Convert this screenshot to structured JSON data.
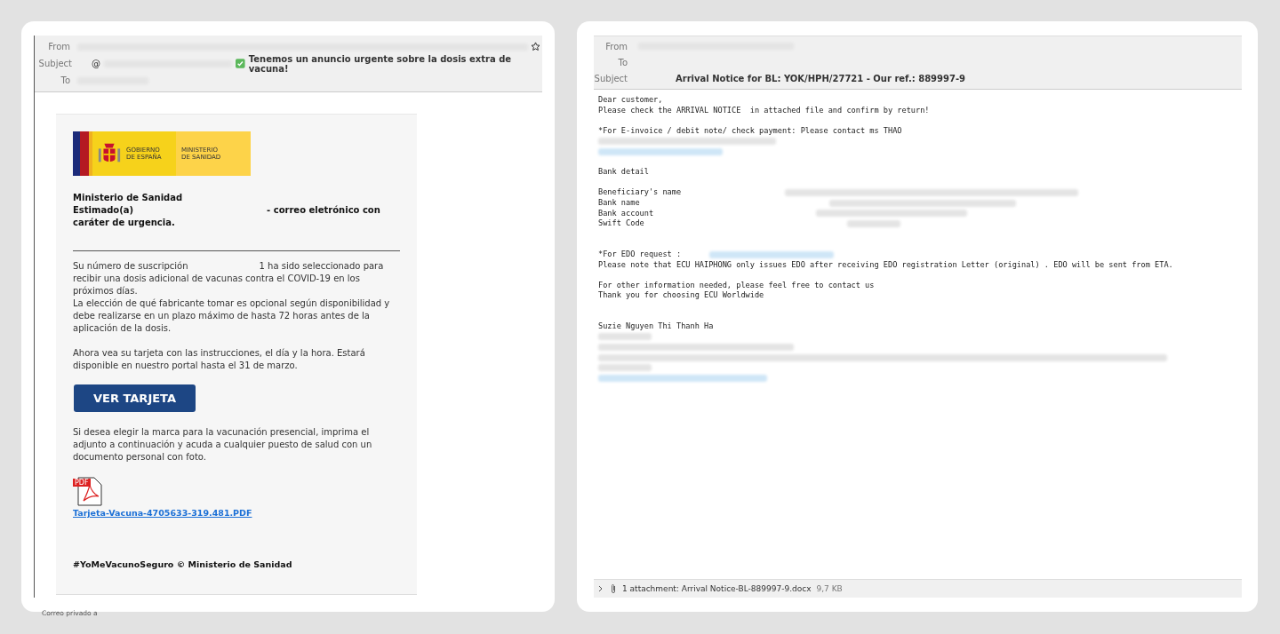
{
  "left_email": {
    "header": [
      {
        "kind": "from",
        "label": "From"
      },
      {
        "kind": "subject",
        "label": "Subject",
        "prefix": "@",
        "value": "Tenemos un anuncio urgente sobre la dosis extra de vacuna!"
      },
      {
        "kind": "to",
        "label": "To"
      }
    ],
    "logo": {
      "left_lines": [
        "GOBIERNO",
        "DE ESPAÑA"
      ],
      "right_lines": [
        "MINISTERIO",
        "DE SANIDAD"
      ]
    },
    "heading": {
      "line1": "Ministerio de Sanidad",
      "greeting": "Estimado(a)",
      "rest": "- correo eletrónico con caráter de urgencia."
    },
    "intro": {
      "before": "Su número de suscripción",
      "after": "1 ha sido seleccionado para recibir una dosis adicional de vacunas contra el COVID-19 en los próximos días.",
      "second": "La elección de qué fabricante tomar es opcional según disponibilidad y debe realizarse en un plazo máximo de hasta 72 horas antes de la aplicación de la dosis."
    },
    "paragraph2": "Ahora vea su tarjeta con las instrucciones, el día y la hora. Estará disponible en nuestro portal hasta el 31 de marzo.",
    "button": "VER TARJETA",
    "paragraph3": "Si desea elegir la marca para la vacunación presencial, imprima el adjunto a continuación y acuda a cualquier puesto de salud con un documento personal con foto.",
    "attachment": {
      "icon_label": "PDF",
      "link": "Tarjeta-Vacuna-4705633-319.481.PDF"
    },
    "footer": "#YoMeVacunoSeguro © Ministerio de Sanidad",
    "private_note": "Correo privado a"
  },
  "right_email": {
    "header": [
      {
        "kind": "from",
        "label": "From"
      },
      {
        "kind": "to",
        "label": "To"
      },
      {
        "kind": "subject",
        "label": "Subject",
        "value": "Arrival Notice for BL: YOK/HPH/27721 - Our ref.: 889997-9"
      }
    ],
    "lines": [
      {
        "kind": "text",
        "text": "Dear customer,"
      },
      {
        "kind": "text",
        "text": "Please check the ARRIVAL NOTICE  in attached file and confirm by return!"
      },
      {
        "kind": "gap"
      },
      {
        "kind": "text",
        "text": "*For E-invoice / debit note/ check payment: Please contact ms THAO"
      },
      {
        "kind": "redacted"
      },
      {
        "kind": "redacted_link"
      },
      {
        "kind": "gap"
      },
      {
        "kind": "text",
        "text": "Bank detail"
      },
      {
        "kind": "gap"
      },
      {
        "kind": "field",
        "text": "Beneficiary's name"
      },
      {
        "kind": "field",
        "text": "Bank name"
      },
      {
        "kind": "field",
        "text": "Bank account"
      },
      {
        "kind": "field",
        "text": "Swift Code"
      },
      {
        "kind": "gap"
      },
      {
        "kind": "gap"
      },
      {
        "kind": "field_link",
        "text": "*For EDO request :"
      },
      {
        "kind": "text",
        "text": "Please note that ECU HAIPHONG only issues EDO after receiving EDO registration Letter (original) . EDO will be sent from ETA."
      },
      {
        "kind": "gap"
      },
      {
        "kind": "text",
        "text": "For other information needed, please feel free to contact us"
      },
      {
        "kind": "text",
        "text": "Thank you for choosing ECU Worldwide"
      },
      {
        "kind": "gap"
      },
      {
        "kind": "gap"
      },
      {
        "kind": "text",
        "text": "Suzie Nguyen Thi Thanh Ha"
      },
      {
        "kind": "redacted"
      },
      {
        "kind": "redacted"
      },
      {
        "kind": "redacted"
      },
      {
        "kind": "redacted"
      },
      {
        "kind": "redacted_link"
      }
    ],
    "attachment_bar": {
      "text": "1 attachment: Arrival Notice-BL-889997-9.docx",
      "size": "9,7 KB"
    }
  }
}
